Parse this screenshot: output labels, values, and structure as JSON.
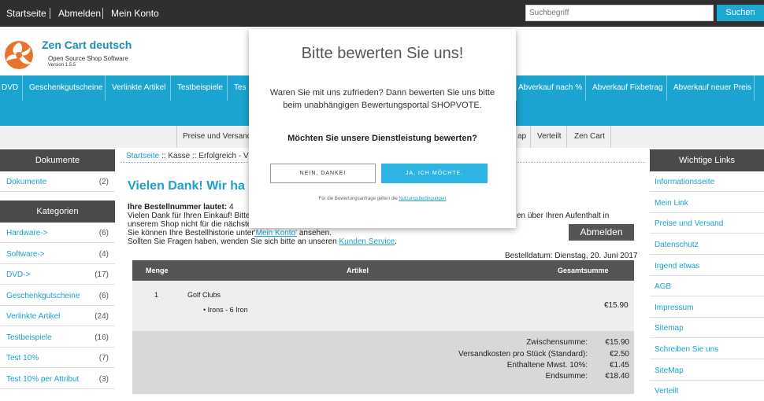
{
  "topbar": {
    "links": [
      "Startseite",
      "Abmelden",
      "Mein Konto"
    ],
    "search_placeholder": "Suchbegriff",
    "search_button": "Suchen"
  },
  "logo": {
    "title": "Zen Cart deutsch",
    "subtitle": "Open Source Shop Software",
    "version": "Version 1.5.5"
  },
  "nav1": [
    "DVD",
    "Geschenkgutscheine",
    "Verlinkte Artikel",
    "Testbeispiele",
    "Tes",
    "Abverkauf nach %",
    "Abverkauf Fixbetrag",
    "Abverkauf neuer Preis"
  ],
  "nav3": [
    "Preise und Versand",
    "ap",
    "Verteilt",
    "Zen Cart"
  ],
  "left_sidebar": {
    "documents_heading": "Dokumente",
    "documents": [
      {
        "label": "Dokumente",
        "count": "(2)"
      }
    ],
    "categories_heading": "Kategorien",
    "categories": [
      {
        "label": "Hardware->",
        "count": "(6)"
      },
      {
        "label": "Software->",
        "count": "(4)"
      },
      {
        "label": "DVD->",
        "count": "(17)"
      },
      {
        "label": "Geschenkgutscheine",
        "count": "(6)"
      },
      {
        "label": "Verlinkte Artikel",
        "count": "(24)"
      },
      {
        "label": "Testbeispiele",
        "count": "(16)"
      },
      {
        "label": "Test 10%",
        "count": "(7)"
      },
      {
        "label": "Test 10% per Attribut",
        "count": "(3)"
      }
    ]
  },
  "right_sidebar": {
    "heading": "Wichtige Links",
    "links": [
      "Informationsseite",
      "Mein Link",
      "Preise und Versand",
      "Datenschutz",
      "Irgend etwas",
      "AGB",
      "Impressum",
      "Sitemap",
      "Schreiben Sie uns",
      "SiteMap",
      "Verteilt"
    ]
  },
  "breadcrumb": {
    "home": "Startseite",
    "rest": " :: Kasse :: Erfolgreich - V"
  },
  "main": {
    "title": "Vielen Dank! Wir ha",
    "order_number_label": "Ihre Bestellnummer lautet:",
    "order_number": "4",
    "line1_start": "Vielen Dank für Ihren Einkauf! Bitte",
    "line1_end": "en über Ihren Aufenthalt in",
    "line2": "unserem Shop nicht für die nächste",
    "line3_pre": "Sie können Ihre Bestellhistorie unter",
    "line3_link": "'Mein Konto'",
    "line3_post": " ansehen.",
    "line4_pre": "Sollten Sie Fragen haben, wenden Sie sich bitte an unseren ",
    "line4_link": "Kunden Service",
    "line4_post": ".",
    "logout_button": "Abmelden",
    "order_date": "Bestelldatum: Dienstag, 20. Juni 2017"
  },
  "order_table": {
    "headers": [
      "Menge",
      "Artikel",
      "Gesamtsumme"
    ],
    "row": {
      "qty": "1",
      "product": "Golf Clubs",
      "attribute": "• Irons - 6 Iron",
      "total": "€15.90"
    },
    "totals": [
      {
        "label": "Zwischensumme:",
        "value": "€15.90"
      },
      {
        "label": "Versandkosten pro Stück (Standard):",
        "value": "€2.50"
      },
      {
        "label": "Enthaltene Mwst. 10%:",
        "value": "€1.45"
      },
      {
        "label": "Endsumme:",
        "value": "€18.40"
      }
    ]
  },
  "modal": {
    "title": "Bitte bewerten Sie uns!",
    "text": "Waren Sie mit uns zufrieden? Dann bewerten Sie uns bitte beim unabhängigen Bewertungsportal SHOPVOTE.",
    "question": "Möchten Sie unsere Dienstleistung bewerten?",
    "no_button": "NEIN, DANKE!",
    "yes_button": "JA, ICH MÖCHTE.",
    "footer_pre": "Für die Bewertungsanfrage gelten die ",
    "footer_link": "Nutzungsbedingungen"
  },
  "colors": {
    "accent": "#1ba4d0",
    "dark_bar": "#2f2f2f",
    "box_heading": "#4a4a4a",
    "logo_orange": "#e8732a"
  }
}
